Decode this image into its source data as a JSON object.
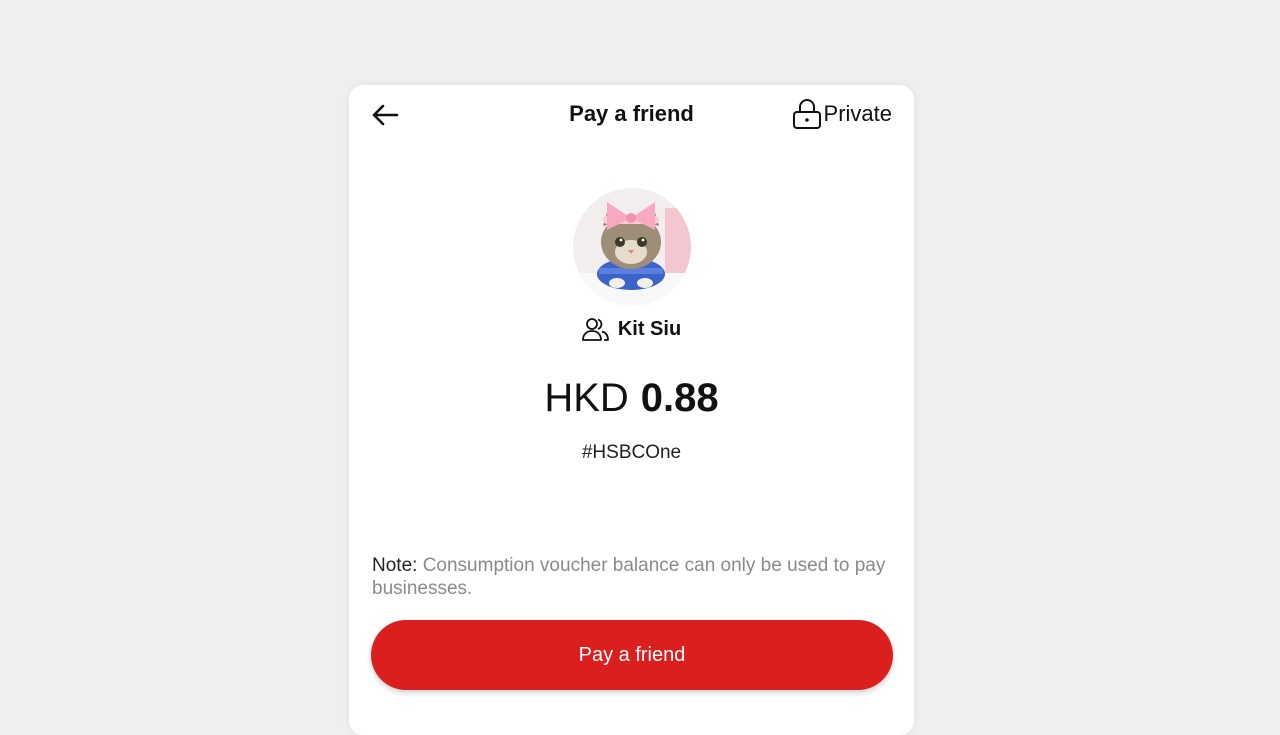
{
  "header": {
    "title": "Pay a friend",
    "privacy_label": "Private",
    "back_icon": "arrow-left-icon",
    "privacy_icon": "lock-icon"
  },
  "recipient": {
    "name": "Kit Siu",
    "icon": "people-icon",
    "avatar": "cat-avatar-image"
  },
  "payment": {
    "currency": "HKD",
    "amount": "0.88",
    "message": "#HSBCOne"
  },
  "note": {
    "label": "Note:",
    "text": " Consumption voucher balance can only be used to pay businesses."
  },
  "action": {
    "pay_label": "Pay a friend"
  },
  "colors": {
    "accent": "#db1f1f",
    "background": "#efefef",
    "card": "#ffffff"
  }
}
